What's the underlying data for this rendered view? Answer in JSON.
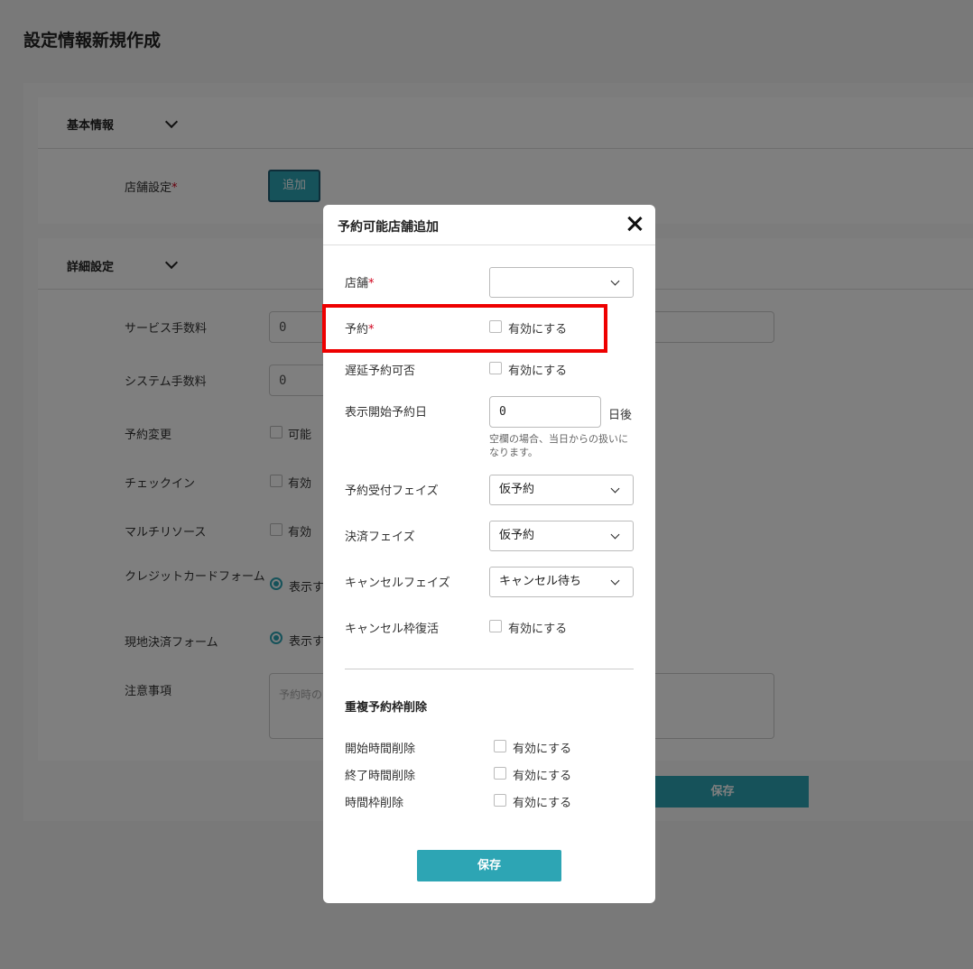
{
  "page": {
    "title": "設定情報新規作成"
  },
  "basic_section": {
    "title": "基本情報",
    "store_setting_label": "店舗設定",
    "required_mark": "*",
    "add_button": "追加"
  },
  "detail_section": {
    "title": "詳細設定",
    "rows": {
      "service_fee": {
        "label": "サービス手数料",
        "value": "0"
      },
      "system_fee": {
        "label": "システム手数料",
        "value": "0"
      },
      "reservation_change": {
        "label": "予約変更",
        "option": "可能"
      },
      "checkin": {
        "label": "チェックイン",
        "option": "有効"
      },
      "multi_resource": {
        "label": "マルチリソース",
        "option": "有効"
      },
      "credit_form": {
        "label": "クレジットカードフォーム",
        "option": "表示す"
      },
      "onsite_form": {
        "label": "現地決済フォーム",
        "option": "表示す"
      },
      "notes": {
        "label": "注意事項",
        "placeholder": "予約時の"
      }
    },
    "save_button": "保存"
  },
  "modal": {
    "title": "予約可能店舗追加",
    "store": {
      "label": "店舗",
      "value": ""
    },
    "reservation": {
      "label": "予約",
      "checkbox_label": "有効にする"
    },
    "late_reservation": {
      "label": "遅延予約可否",
      "checkbox_label": "有効にする"
    },
    "display_start": {
      "label": "表示開始予約日",
      "value": "0",
      "unit": "日後",
      "help": "空欄の場合、当日からの扱いになります。"
    },
    "acceptance_phase": {
      "label": "予約受付フェイズ",
      "value": "仮予約"
    },
    "payment_phase": {
      "label": "決済フェイズ",
      "value": "仮予約"
    },
    "cancel_phase": {
      "label": "キャンセルフェイズ",
      "value": "キャンセル待ち"
    },
    "cancel_restore": {
      "label": "キャンセル枠復活",
      "checkbox_label": "有効にする"
    },
    "duplicate_section": {
      "title": "重複予約枠削除",
      "start_time": {
        "label": "開始時間削除",
        "checkbox_label": "有効にする"
      },
      "end_time": {
        "label": "終了時間削除",
        "checkbox_label": "有効にする"
      },
      "time_slot": {
        "label": "時間枠削除",
        "checkbox_label": "有効にする"
      }
    },
    "save_button": "保存"
  },
  "colors": {
    "accent": "#2da5b4",
    "highlight": "#ee0000",
    "required": "#d0021b"
  }
}
